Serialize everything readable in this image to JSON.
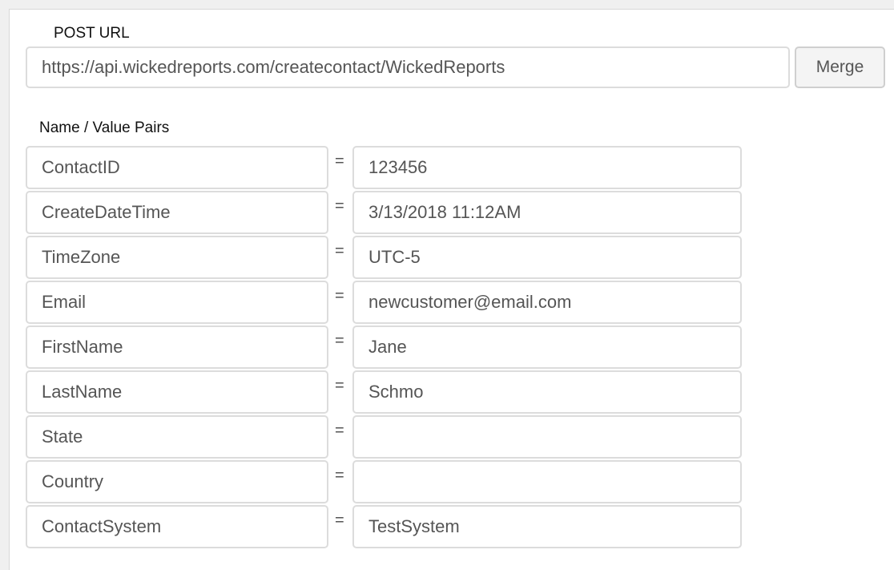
{
  "form": {
    "post_url_label": "POST URL",
    "post_url_value": "https://api.wickedreports.com/createcontact/WickedReports",
    "merge_label": "Merge",
    "pairs_label": "Name / Value Pairs",
    "equals_sign": "=",
    "pairs": [
      {
        "name": "ContactID",
        "value": "123456"
      },
      {
        "name": "CreateDateTime",
        "value": "3/13/2018 11:12AM"
      },
      {
        "name": "TimeZone",
        "value": "UTC-5"
      },
      {
        "name": "Email",
        "value": "newcustomer@email.com"
      },
      {
        "name": "FirstName",
        "value": "Jane"
      },
      {
        "name": "LastName",
        "value": "Schmo"
      },
      {
        "name": "State",
        "value": ""
      },
      {
        "name": "Country",
        "value": ""
      },
      {
        "name": "ContactSystem",
        "value": "TestSystem"
      }
    ]
  }
}
